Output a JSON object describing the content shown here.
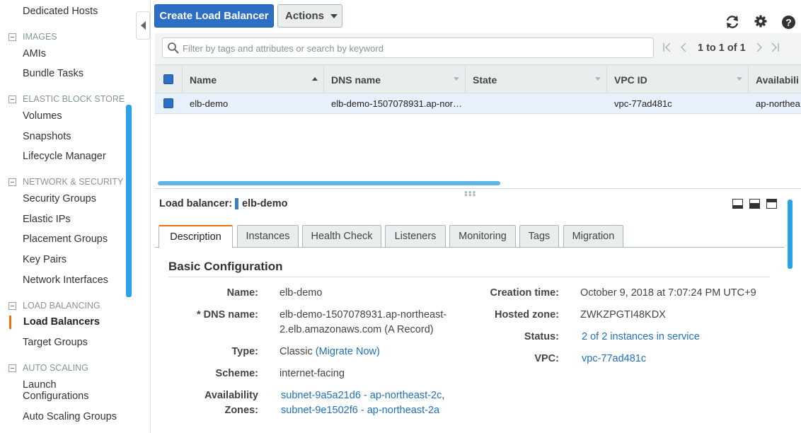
{
  "sidebar": {
    "items_top": [
      "Dedicated Hosts"
    ],
    "sections": [
      {
        "header": "IMAGES",
        "items": [
          "AMIs",
          "Bundle Tasks"
        ]
      },
      {
        "header": "ELASTIC BLOCK STORE",
        "items": [
          "Volumes",
          "Snapshots",
          "Lifecycle Manager"
        ]
      },
      {
        "header": "NETWORK & SECURITY",
        "items": [
          "Security Groups",
          "Elastic IPs",
          "Placement Groups",
          "Key Pairs",
          "Network Interfaces"
        ]
      },
      {
        "header": "LOAD BALANCING",
        "items": [
          "Load Balancers",
          "Target Groups"
        ]
      },
      {
        "header": "AUTO SCALING",
        "items": [
          "Launch Configurations",
          "Auto Scaling Groups"
        ]
      }
    ],
    "active_item": "Load Balancers",
    "launch_line1": "Launch",
    "launch_line2": "Configurations"
  },
  "toolbar": {
    "create_label": "Create Load Balancer",
    "actions_label": "Actions",
    "icons": [
      "refresh-icon",
      "gear-icon",
      "help-icon"
    ]
  },
  "filter": {
    "placeholder": "Filter by tags and attributes or search by keyword",
    "page_count": "1 to 1 of 1"
  },
  "table": {
    "columns": [
      "Name",
      "DNS name",
      "State",
      "VPC ID",
      "Availabili"
    ],
    "rows": [
      {
        "name": "elb-demo",
        "dns": "elb-demo-1507078931.ap-nor…",
        "state": "",
        "vpc": "vpc-77ad481c",
        "az": "ap-northea"
      }
    ]
  },
  "detail": {
    "label": "Load balancer:",
    "name": "elb-demo",
    "tabs": [
      "Description",
      "Instances",
      "Health Check",
      "Listeners",
      "Monitoring",
      "Tags",
      "Migration"
    ],
    "active_tab": "Description",
    "section_title": "Basic Configuration",
    "left": {
      "name_label": "Name:",
      "name_value": "elb-demo",
      "dns_label": "* DNS name:",
      "dns_value_line1": "elb-demo-1507078931.ap-northeast-",
      "dns_value_line2": "2.elb.amazonaws.com (A Record)",
      "type_label": "Type:",
      "type_value": "Classic",
      "type_link": "(Migrate Now)",
      "scheme_label": "Scheme:",
      "scheme_value": "internet-facing",
      "az_label_line1": "Availability",
      "az_label_line2": "Zones:",
      "az_value_1": "subnet-9a5a21d6 - ap-northeast-2c",
      "az_sep": ",",
      "az_value_2": "subnet-9e1502f6 - ap-northeast-2a"
    },
    "right": {
      "creation_label": "Creation time:",
      "creation_value": "October 9, 2018 at 7:07:24 PM UTC+9",
      "zone_label": "Hosted zone:",
      "zone_value": "ZWKZPGTI48KDX",
      "status_label": "Status:",
      "status_value": "2 of 2 instances in service",
      "vpc_label": "VPC:",
      "vpc_value": "vpc-77ad481c"
    }
  },
  "colors": {
    "primary_button": "#2c6fc4",
    "active_accent": "#ec7211",
    "link": "#2170c0",
    "selected_row": "#e7f1fb"
  }
}
